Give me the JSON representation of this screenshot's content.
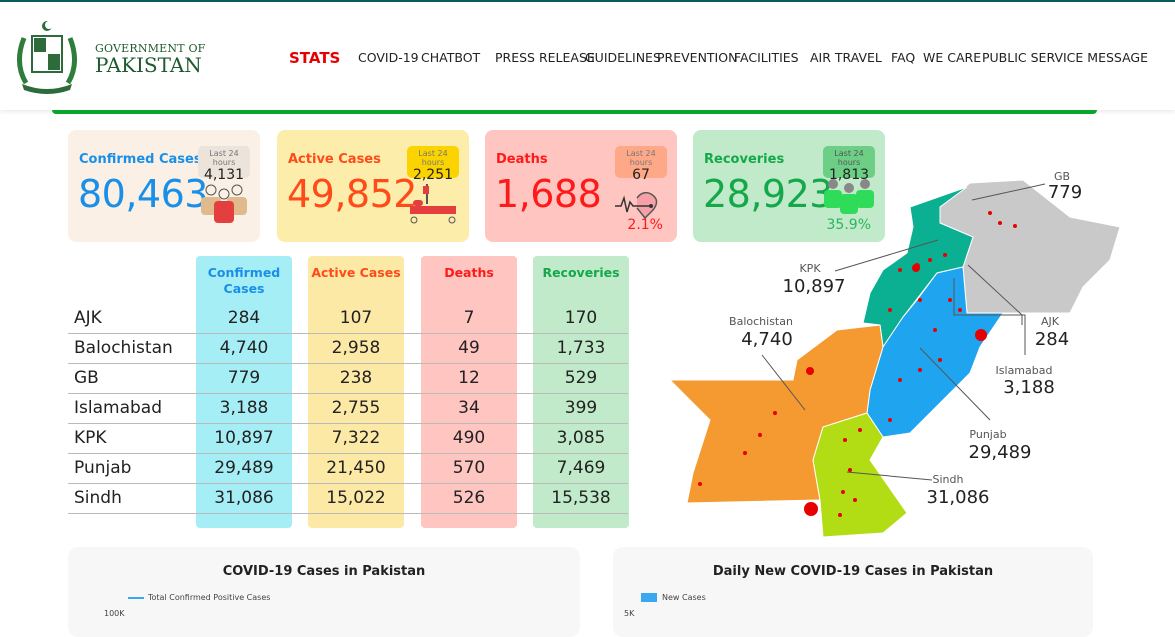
{
  "header": {
    "gov_line1": "GOVERNMENT OF",
    "gov_line2": "PAKISTAN",
    "nav": [
      "STATS",
      "COVID-19",
      "CHATBOT",
      "PRESS RELEASE",
      "GUIDELINES",
      "PREVENTION",
      "FACILITIES",
      "AIR TRAVEL",
      "FAQ",
      "WE CARE",
      "PUBLIC SERVICE MESSAGE"
    ],
    "active": "STATS"
  },
  "cards": [
    {
      "title": "Confirmed Cases",
      "value": "80,463",
      "last24_label": "Last 24 hours",
      "last24": "4,131",
      "icon": "people-icon",
      "color": "#1a8fe8",
      "bg": "#fbf0e6"
    },
    {
      "title": "Active Cases",
      "value": "49,852",
      "last24_label": "Last 24 hours",
      "last24": "2,251",
      "icon": "hospital-bed-icon",
      "color": "#ff4a1a",
      "bg": "#fdedaa"
    },
    {
      "title": "Deaths",
      "value": "1,688",
      "last24_label": "Last 24 hours",
      "last24": "67",
      "percent": "2.1%",
      "icon": "heartbeat-icon",
      "color": "#ff1a1a",
      "bg": "#fec5c1"
    },
    {
      "title": "Recoveries",
      "value": "28,923",
      "last24_label": "Last 24 hours",
      "last24": "1,813",
      "percent": "35.9%",
      "icon": "recovered-people-icon",
      "color": "#14a84a",
      "bg": "#c0eac9"
    }
  ],
  "table": {
    "headers": [
      "Confirmed Cases",
      "Active Cases",
      "Deaths",
      "Recoveries"
    ],
    "rows": [
      {
        "region": "AJK",
        "confirmed": "284",
        "active": "107",
        "deaths": "7",
        "recoveries": "170"
      },
      {
        "region": "Balochistan",
        "confirmed": "4,740",
        "active": "2,958",
        "deaths": "49",
        "recoveries": "1,733"
      },
      {
        "region": "GB",
        "confirmed": "779",
        "active": "238",
        "deaths": "12",
        "recoveries": "529"
      },
      {
        "region": "Islamabad",
        "confirmed": "3,188",
        "active": "2,755",
        "deaths": "34",
        "recoveries": "399"
      },
      {
        "region": "KPK",
        "confirmed": "10,897",
        "active": "7,322",
        "deaths": "490",
        "recoveries": "3,085"
      },
      {
        "region": "Punjab",
        "confirmed": "29,489",
        "active": "21,450",
        "deaths": "570",
        "recoveries": "7,469"
      },
      {
        "region": "Sindh",
        "confirmed": "31,086",
        "active": "15,022",
        "deaths": "526",
        "recoveries": "15,538"
      }
    ]
  },
  "map": {
    "labels": [
      {
        "name": "GB",
        "value": "779"
      },
      {
        "name": "KPK",
        "value": "10,897"
      },
      {
        "name": "AJK",
        "value": "284"
      },
      {
        "name": "Balochistan",
        "value": "4,740"
      },
      {
        "name": "Islamabad",
        "value": "3,188"
      },
      {
        "name": "Punjab",
        "value": "29,489"
      },
      {
        "name": "Sindh",
        "value": "31,086"
      }
    ]
  },
  "charts": [
    {
      "title": "COVID-19 Cases in Pakistan",
      "legend": "Total Confirmed Positive Cases",
      "ytick": "100K"
    },
    {
      "title": "Daily New COVID-19 Cases in Pakistan",
      "legend": "New Cases",
      "ytick": "5K"
    }
  ]
}
